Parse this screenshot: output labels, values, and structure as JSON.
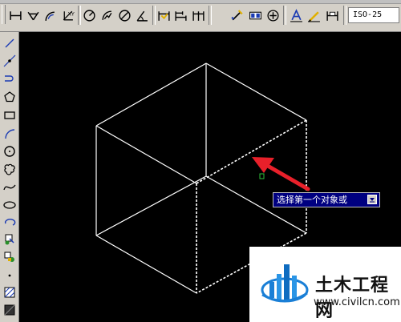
{
  "toolbar": {
    "dim_style_value": "ISO-25",
    "icons": [
      "dim-linear-icon",
      "dim-aligned-icon",
      "dim-arc-icon",
      "dim-ordinate-icon",
      "dim-radius-icon",
      "dim-jogged-icon",
      "dim-diameter-icon",
      "dim-angular-icon",
      "quick-dim-icon",
      "dim-baseline-icon",
      "dim-continue-icon",
      "dim-space-icon",
      "dim-break-icon",
      "tolerance-icon",
      "center-mark-icon",
      "dim-edit-icon",
      "dim-text-edit-icon",
      "dim-update-icon"
    ]
  },
  "left_toolbar": {
    "icons": [
      "line-icon",
      "construction-line-icon",
      "polyline-icon",
      "polygon-icon",
      "rectangle-icon",
      "arc-icon",
      "circle-icon",
      "revision-cloud-icon",
      "spline-icon",
      "ellipse-icon",
      "ellipse-arc-icon",
      "insert-block-icon",
      "make-block-icon",
      "point-icon",
      "hatch-icon",
      "gradient-icon"
    ]
  },
  "canvas": {
    "prompt_tooltip": "选择第一个对象或",
    "colors": {
      "background": "#000000",
      "lines": "#ffffff",
      "arrow": "#e8202a",
      "tooltip_bg": "#000080"
    }
  },
  "watermark": {
    "title": "土木工程网",
    "url": "www.civilcn.com"
  }
}
